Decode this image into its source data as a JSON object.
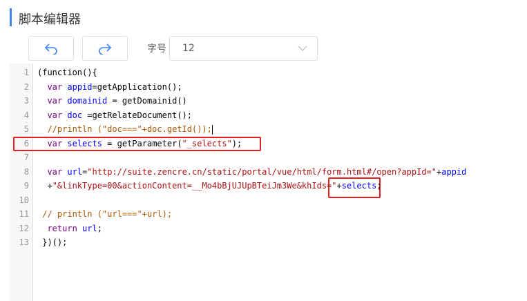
{
  "header": {
    "title": "脚本编辑器"
  },
  "toolbar": {
    "undo_icon": "undo-icon",
    "redo_icon": "redo-icon",
    "font_size_label": "字号",
    "font_size_value": "12"
  },
  "editor": {
    "lines": [
      {
        "n": "1",
        "parts": [
          {
            "t": "(function(){",
            "c": ""
          }
        ]
      },
      {
        "n": "2",
        "parts": [
          {
            "t": "  ",
            "c": ""
          },
          {
            "t": "var",
            "c": "kw"
          },
          {
            "t": " ",
            "c": ""
          },
          {
            "t": "appid",
            "c": "vr"
          },
          {
            "t": "=getApplication();",
            "c": ""
          }
        ]
      },
      {
        "n": "3",
        "parts": [
          {
            "t": "  ",
            "c": ""
          },
          {
            "t": "var",
            "c": "kw"
          },
          {
            "t": " ",
            "c": ""
          },
          {
            "t": "domainid",
            "c": "vr"
          },
          {
            "t": " = getDomainid()",
            "c": ""
          }
        ]
      },
      {
        "n": "4",
        "parts": [
          {
            "t": "  ",
            "c": ""
          },
          {
            "t": "var",
            "c": "kw"
          },
          {
            "t": " ",
            "c": ""
          },
          {
            "t": "doc",
            "c": "vr"
          },
          {
            "t": " =getRelateDocument();",
            "c": ""
          }
        ]
      },
      {
        "n": "5",
        "parts": [
          {
            "t": "  //println (\"doc===\"+doc.getId());",
            "c": "cm"
          }
        ]
      },
      {
        "n": "6",
        "parts": [
          {
            "t": "  ",
            "c": ""
          },
          {
            "t": "var",
            "c": "kw"
          },
          {
            "t": " ",
            "c": ""
          },
          {
            "t": "selects",
            "c": "vr"
          },
          {
            "t": " = getParameter(",
            "c": ""
          },
          {
            "t": "\"_selects\"",
            "c": "st"
          },
          {
            "t": ");",
            "c": ""
          }
        ]
      },
      {
        "n": "7",
        "parts": []
      },
      {
        "n": "8",
        "parts": [
          {
            "t": "  ",
            "c": ""
          },
          {
            "t": "var",
            "c": "kw"
          },
          {
            "t": " ",
            "c": ""
          },
          {
            "t": "url",
            "c": "vr"
          },
          {
            "t": "=",
            "c": ""
          },
          {
            "t": "\"http://suite.zencre.cn/static/portal/vue/html/form.html#/open?appId=\"",
            "c": "st"
          },
          {
            "t": "+",
            "c": ""
          },
          {
            "t": "appid",
            "c": "vr"
          }
        ]
      },
      {
        "n": "9",
        "parts": [
          {
            "t": "  +",
            "c": ""
          },
          {
            "t": "\"&linkType=00&actionContent=__Mo4bBjUJUpBTeiJm3We&khIds=\"",
            "c": "st"
          },
          {
            "t": "+",
            "c": ""
          },
          {
            "t": "selects",
            "c": "vr"
          },
          {
            "t": ";",
            "c": ""
          }
        ]
      },
      {
        "n": "10",
        "parts": []
      },
      {
        "n": "11",
        "parts": [
          {
            "t": " // println (\"url===\"+url);",
            "c": "cm"
          }
        ]
      },
      {
        "n": "12",
        "parts": [
          {
            "t": "  ",
            "c": ""
          },
          {
            "t": "return",
            "c": "kw"
          },
          {
            "t": " ",
            "c": ""
          },
          {
            "t": "url",
            "c": "vr"
          },
          {
            "t": ";",
            "c": ""
          }
        ]
      },
      {
        "n": "13",
        "parts": [
          {
            "t": " })();",
            "c": ""
          }
        ]
      }
    ]
  },
  "annotations": [
    {
      "name": "highlight-line-6",
      "color": "#e02020"
    },
    {
      "name": "highlight-selects",
      "color": "#e02020"
    }
  ]
}
